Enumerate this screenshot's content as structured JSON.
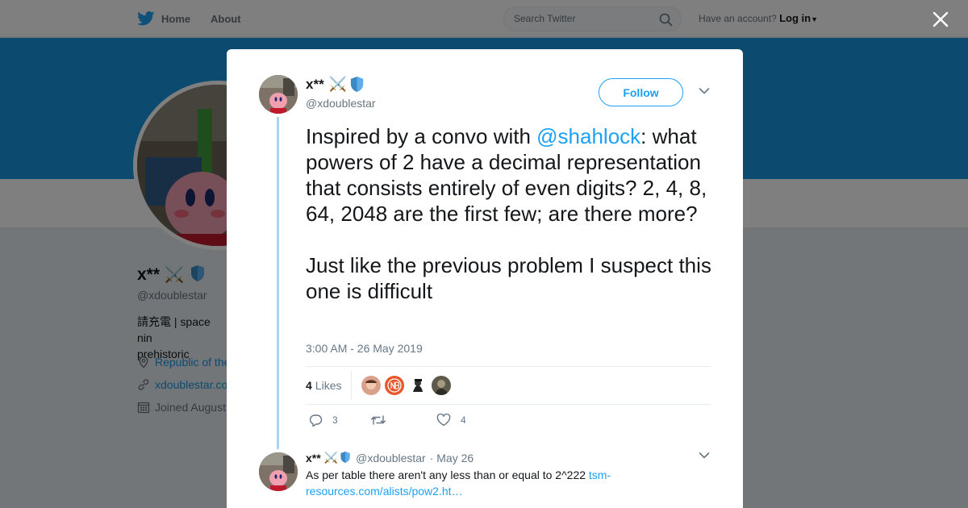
{
  "nav": {
    "home_label": "Home",
    "about_label": "About",
    "search_placeholder": "Search Twitter",
    "account_prompt": "Have an account?",
    "login_label": "Log in"
  },
  "profile": {
    "name": "x**",
    "handle": "@xdoublestar",
    "bio": "請充電 | space nin\nprehistoric",
    "location": "Republic of the",
    "url": "xdoublestar.co",
    "joined": "Joined August"
  },
  "tweet": {
    "author_name": "x**",
    "author_handle": "@xdoublestar",
    "follow_label": "Follow",
    "text_before": "Inspired by a convo with ",
    "mention": "@shahlock",
    "text_after": ": what powers of 2 have a decimal representation that consists entirely of even digits? 2, 4, 8, 64, 2048 are the first few; are there more?",
    "text_second": "Just like the previous problem I suspect this one is difficult",
    "timestamp": "3:00 AM - 26 May 2019",
    "likes_count": "4",
    "likes_label": "Likes",
    "replies_count": "3",
    "retweets_count": "",
    "likes_action_count": "4"
  },
  "reply": {
    "author_name": "x**",
    "author_handle": "@xdoublestar",
    "date": "· May 26",
    "text": "As per table there aren't any less than or equal to 2^222 ",
    "link": "tsm-resources.com/alists/pow2.ht…"
  },
  "colors": {
    "brand": "#1da1f2",
    "banner": "#1b95e0",
    "thread_line": "#a8d4f2"
  },
  "icons": [
    "twitter-bird-icon",
    "search-icon",
    "close-icon",
    "crossed-swords-icon",
    "shield-icon",
    "chevron-down-icon",
    "location-pin-icon",
    "link-icon",
    "calendar-icon",
    "reply-icon",
    "retweet-icon",
    "heart-icon"
  ]
}
